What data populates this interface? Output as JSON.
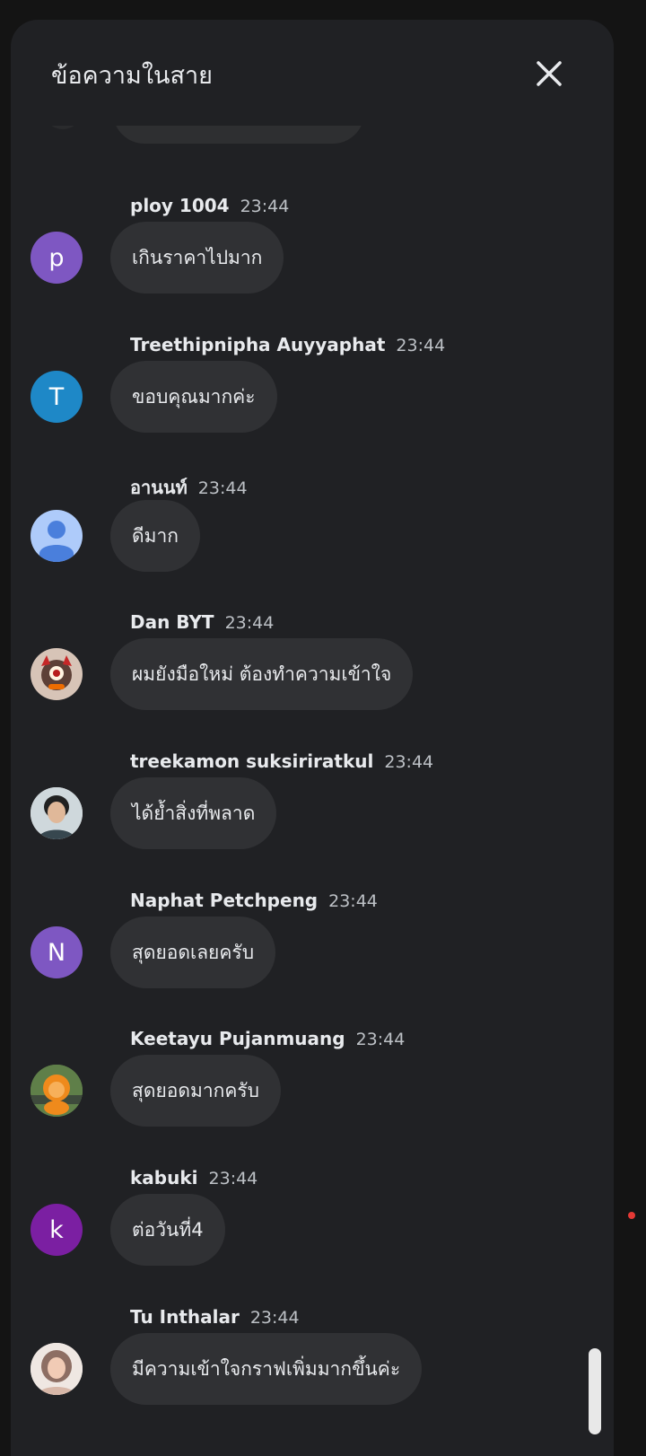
{
  "header": {
    "title": "ข้อความในสาย"
  },
  "colors": {
    "panel_bg": "#202124",
    "bubble_bg": "#303134",
    "text": "#e8eaed"
  },
  "messages": [
    {
      "author": "ploy 1004",
      "time": "23:44",
      "text": "เกินราคาไปมาก",
      "avatar_letter": "p",
      "avatar_color": "#7e57c2"
    },
    {
      "author": "Treethipnipha Auyyaphat",
      "time": "23:44",
      "text": "ขอบคุณมากค่ะ",
      "avatar_letter": "T",
      "avatar_color": "#1e88c7"
    },
    {
      "author": "อานนท์",
      "time": "23:44",
      "text": "ดีมาก",
      "avatar_letter": "",
      "avatar_color": "#aecbfa"
    },
    {
      "author": "Dan BYT",
      "time": "23:44",
      "text": "ผมยังมือใหม่ ต้องทำความเข้าใจ",
      "avatar_letter": "",
      "avatar_color": "#6d4c41"
    },
    {
      "author": "treekamon suksiriratkul",
      "time": "23:44",
      "text": "ได้ย้ำสิ่งที่พลาด",
      "avatar_letter": "",
      "avatar_color": "#8d8d8d"
    },
    {
      "author": "Naphat Petchpeng",
      "time": "23:44",
      "text": "สุดยอดเลยครับ",
      "avatar_letter": "N",
      "avatar_color": "#7e57c2"
    },
    {
      "author": "Keetayu Pujanmuang",
      "time": "23:44",
      "text": "สุดยอดมากครับ",
      "avatar_letter": "",
      "avatar_color": "#4e6b3a"
    },
    {
      "author": "kabuki",
      "time": "23:44",
      "text": "ต่อวันที่4",
      "avatar_letter": "k",
      "avatar_color": "#7b1fa2"
    },
    {
      "author": "Tu Inthalar",
      "time": "23:44",
      "text": "มีความเข้าใจกราฟเพิ่มมากขึ้นค่ะ",
      "avatar_letter": "",
      "avatar_color": "#c9a9a0"
    }
  ]
}
